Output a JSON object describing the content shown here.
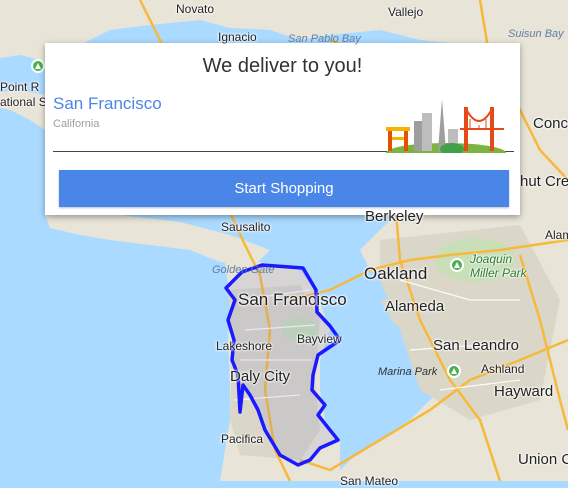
{
  "card": {
    "title": "We deliver to you!",
    "city": "San Francisco",
    "state": "California",
    "button_label": "Start Shopping"
  },
  "map": {
    "labels": {
      "novato": "Novato",
      "vallejo": "Vallejo",
      "suisun_bay": "Suisun Bay",
      "ignacio": "Ignacio",
      "san_pablo_bay": "San Pablo Bay",
      "point_r": "Point R",
      "national_s": "ational Se",
      "conc": "Conc",
      "hut_cree": "hut Cree",
      "berkeley": "Berkeley",
      "sausalito": "Sausalito",
      "alam": "Alam",
      "joaquin_miller": "Joaquin\nMiller Park",
      "golden_gate": "Golden Gate",
      "oakland": "Oakland",
      "san_francisco": "San Francisco",
      "alameda": "Alameda",
      "bayview": "Bayview",
      "lakeshore": "Lakeshore",
      "san_leandro": "San Leandro",
      "daly_city": "Daly City",
      "marina_park": "Marina Park",
      "ashland": "Ashland",
      "hayward": "Hayward",
      "pacifica": "Pacifica",
      "union_c": "Union C",
      "san_mateo": "San Mateo"
    },
    "colors": {
      "water": "#aadaff",
      "land": "#e8e4d8",
      "urban": "#dad6c8",
      "highway": "#f7b93b",
      "delivery_border": "#1a1aff"
    }
  }
}
